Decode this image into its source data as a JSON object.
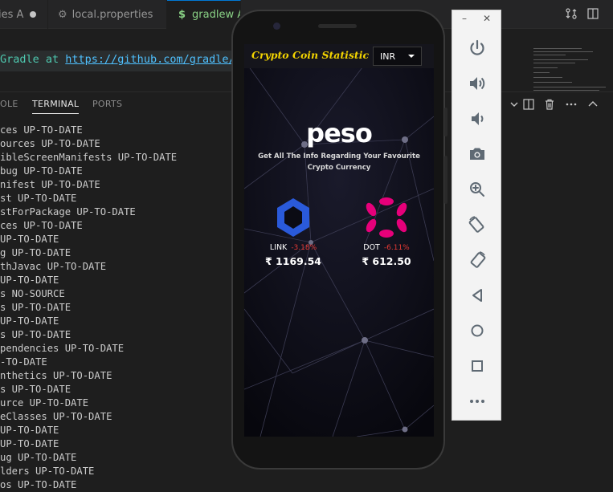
{
  "editor_tabs": [
    {
      "label": "ies A",
      "modified": true
    },
    {
      "label": "local.properties",
      "icon": "gear-icon"
    },
    {
      "label": "gradlew A",
      "icon": "shell-dollar-icon",
      "active": true
    }
  ],
  "editor": {
    "code_prefix": "Gradle at ",
    "code_link": "https://github.com/gradle/gr"
  },
  "panel": {
    "tabs": [
      "OLE",
      "TERMINAL",
      "PORTS"
    ],
    "active_tab": "TERMINAL",
    "terminal_lines": [
      "ces UP-TO-DATE",
      "ources UP-TO-DATE",
      "ibleScreenManifests UP-TO-DATE",
      "bug UP-TO-DATE",
      "nifest UP-TO-DATE",
      "st UP-TO-DATE",
      "stForPackage UP-TO-DATE",
      "ces UP-TO-DATE",
      " UP-TO-DATE",
      "g UP-TO-DATE",
      "thJavac UP-TO-DATE",
      "UP-TO-DATE",
      "s NO-SOURCE",
      "s UP-TO-DATE",
      "UP-TO-DATE",
      "s UP-TO-DATE",
      "pendencies UP-TO-DATE",
      "-TO-DATE",
      "nthetics UP-TO-DATE",
      "s UP-TO-DATE",
      "urce UP-TO-DATE",
      "eClasses UP-TO-DATE",
      "UP-TO-DATE",
      "UP-TO-DATE",
      "ug UP-TO-DATE",
      "lders UP-TO-DATE",
      "os UP-TO-DATE"
    ]
  },
  "app": {
    "title": "Crypto Coin Statistic",
    "currency": "INR",
    "brand": "peso",
    "tagline": "Get All The Info Regarding Your Favourite Crypto Currency",
    "coins": [
      {
        "symbol": "LINK",
        "change": "-3.18%",
        "price": "₹ 1169.54",
        "color": "#2a5ada",
        "icon": "chainlink-logo-icon"
      },
      {
        "symbol": "DOT",
        "change": "-6.11%",
        "price": "₹ 612.50",
        "color": "#e6007a",
        "icon": "polkadot-logo-icon"
      }
    ]
  },
  "emulator": {
    "controls": [
      {
        "name": "power-button",
        "icon": "power-icon"
      },
      {
        "name": "volume-up-button",
        "icon": "volume-up-icon"
      },
      {
        "name": "volume-down-button",
        "icon": "volume-down-icon"
      },
      {
        "name": "screenshot-button",
        "icon": "camera-icon"
      },
      {
        "name": "zoom-button",
        "icon": "zoom-in-icon"
      },
      {
        "name": "rotate-left-button",
        "icon": "rotate-left-icon"
      },
      {
        "name": "rotate-right-button",
        "icon": "rotate-right-icon"
      },
      {
        "name": "back-button",
        "icon": "back-triangle-icon"
      },
      {
        "name": "home-button",
        "icon": "home-circle-icon"
      },
      {
        "name": "overview-button",
        "icon": "overview-square-icon"
      },
      {
        "name": "more-button",
        "icon": "more-dots-icon"
      }
    ]
  }
}
